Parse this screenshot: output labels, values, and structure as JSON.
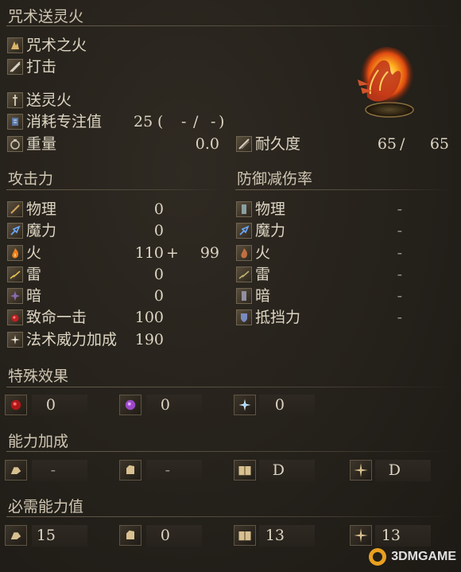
{
  "title": "咒术送灵火",
  "item_icon": "flaming-hand-icon",
  "info_rows": [
    {
      "icon": "pyromancy-flame-icon",
      "label": "咒术之火"
    },
    {
      "icon": "strike-icon",
      "label": "打击"
    },
    {
      "icon": "spell-type-icon",
      "label": "送灵火"
    }
  ],
  "fp_cost": {
    "label": "消耗专注值",
    "value": "25",
    "paren_open": "(",
    "slash1": "-",
    "slash_mid": "/",
    "slash2": "-",
    "paren_close": ")"
  },
  "weight": {
    "label": "重量",
    "value": "0.0"
  },
  "durability": {
    "label": "耐久度",
    "current": "65",
    "sep": "/",
    "max": "65"
  },
  "attack": {
    "header": "攻击力",
    "rows": [
      {
        "icon": "physical-icon",
        "label": "物理",
        "value": "0"
      },
      {
        "icon": "magic-icon",
        "label": "魔力",
        "value": "0"
      },
      {
        "icon": "fire-icon",
        "label": "火",
        "value": "110",
        "plus": "+",
        "bonus": "99"
      },
      {
        "icon": "lightning-icon",
        "label": "雷",
        "value": "0"
      },
      {
        "icon": "dark-icon",
        "label": "暗",
        "value": "0"
      },
      {
        "icon": "critical-icon",
        "label": "致命一击",
        "value": "100"
      },
      {
        "icon": "spell-buff-icon",
        "label": "法术威力加成",
        "value": "190"
      }
    ]
  },
  "defense": {
    "header": "防御减伤率",
    "rows": [
      {
        "icon": "physical-defense-icon",
        "label": "物理",
        "value": "-"
      },
      {
        "icon": "magic-defense-icon",
        "label": "魔力",
        "value": "-"
      },
      {
        "icon": "fire-defense-icon",
        "label": "火",
        "value": "-"
      },
      {
        "icon": "lightning-defense-icon",
        "label": "雷",
        "value": "-"
      },
      {
        "icon": "dark-defense-icon",
        "label": "暗",
        "value": "-"
      },
      {
        "icon": "stability-icon",
        "label": "抵挡力",
        "value": "-"
      }
    ]
  },
  "effects": {
    "header": "特殊效果",
    "items": [
      {
        "icon": "bleed-icon",
        "value": "0"
      },
      {
        "icon": "poison-icon",
        "value": "0"
      },
      {
        "icon": "frost-icon",
        "value": "0"
      }
    ]
  },
  "scaling": {
    "header": "能力加成",
    "items": [
      {
        "icon": "strength-icon",
        "value": "-"
      },
      {
        "icon": "dexterity-icon",
        "value": "-"
      },
      {
        "icon": "intelligence-icon",
        "value": "D"
      },
      {
        "icon": "faith-icon",
        "value": "D"
      }
    ]
  },
  "requirements": {
    "header": "必需能力值",
    "items": [
      {
        "icon": "strength-icon",
        "value": "15"
      },
      {
        "icon": "dexterity-icon",
        "value": "0"
      },
      {
        "icon": "intelligence-icon",
        "value": "13"
      },
      {
        "icon": "faith-icon",
        "value": "13"
      }
    ]
  },
  "watermark": {
    "text": "3DMGAME"
  },
  "colors": {
    "text": "#ddd5c3",
    "header": "#cfc6b2",
    "fire": "#e8761e",
    "bg": "#25211b"
  }
}
